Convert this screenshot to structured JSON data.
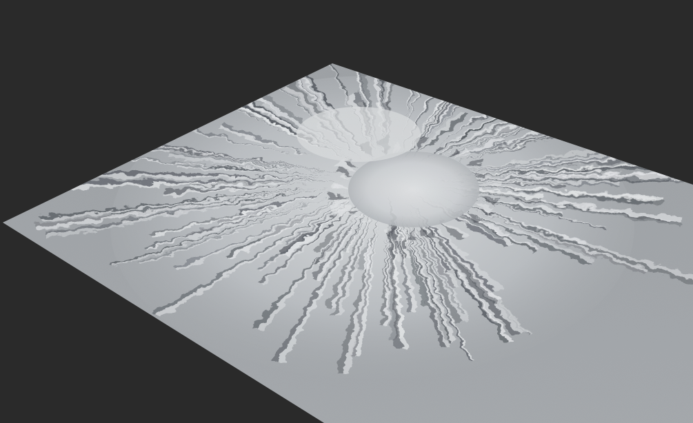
{
  "scene": {
    "background_color": "#2a2a2a",
    "terrain_base_color": "#9a9ea2",
    "terrain_highlight_color": "#e6e8ea",
    "terrain_shadow_color": "#4a4f56",
    "subject": "3d-terrain-heightmap-render"
  }
}
